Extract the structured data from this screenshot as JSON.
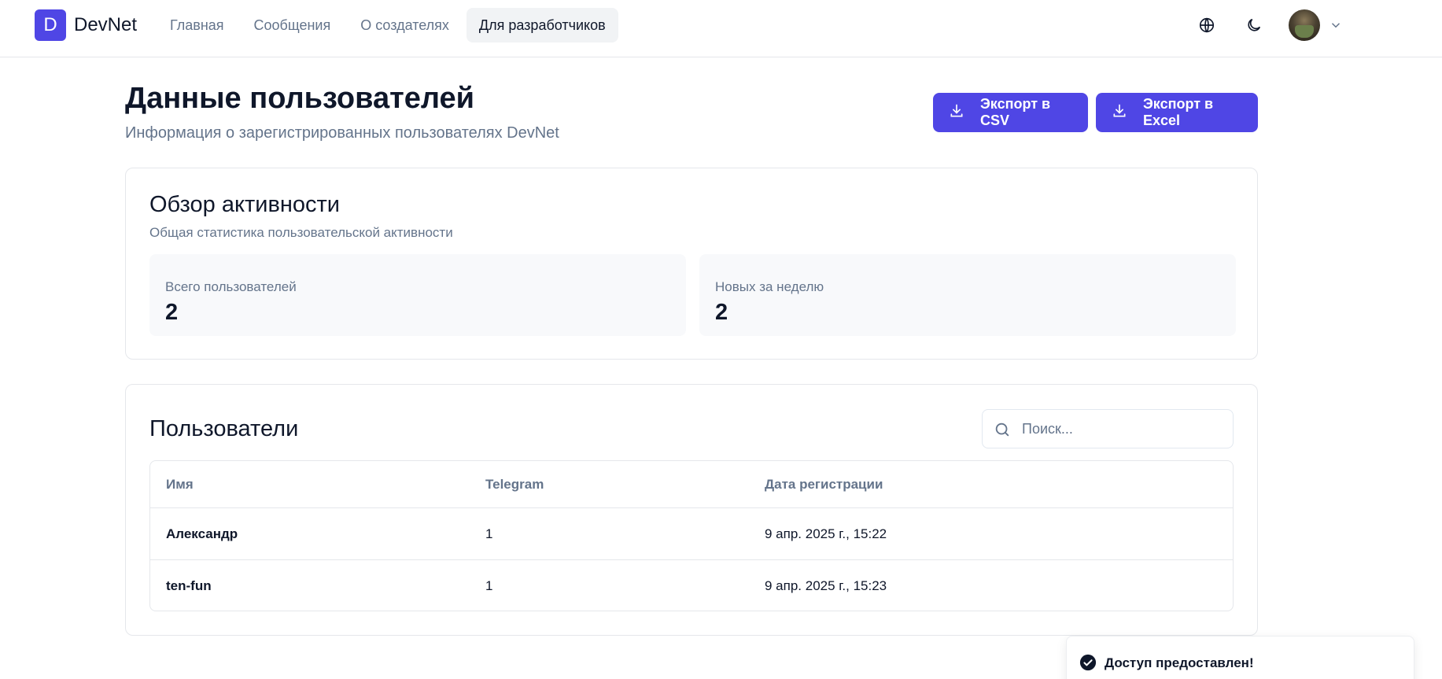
{
  "header": {
    "logo_letter": "D",
    "app_name": "DevNet",
    "nav": [
      {
        "label": "Главная",
        "active": false
      },
      {
        "label": "Сообщения",
        "active": false
      },
      {
        "label": "О создателях",
        "active": false
      },
      {
        "label": "Для разработчиков",
        "active": true
      }
    ],
    "icons": [
      "globe-icon",
      "moon-icon",
      "chevron-down-icon"
    ]
  },
  "page": {
    "title": "Данные пользователей",
    "subtitle": "Информация о зарегистрированных пользователях DevNet",
    "export_csv_label": "Экспорт в CSV",
    "export_excel_label": "Экспорт в Excel"
  },
  "activity": {
    "title": "Обзор активности",
    "subtitle": "Общая статистика пользовательской активности",
    "stats": [
      {
        "label": "Всего пользователей",
        "value": "2"
      },
      {
        "label": "Новых за неделю",
        "value": "2"
      }
    ]
  },
  "users": {
    "title": "Пользователи",
    "search_placeholder": "Поиск...",
    "search_value": "",
    "columns": [
      "Имя",
      "Telegram",
      "Дата регистрации"
    ],
    "rows": [
      {
        "name": "Александр",
        "telegram": "1",
        "registered": "9 апр. 2025 г., 15:22"
      },
      {
        "name": "ten-fun",
        "telegram": "1",
        "registered": "9 апр. 2025 г., 15:23"
      }
    ]
  },
  "toast": {
    "message": "Доступ предоставлен!"
  },
  "colors": {
    "accent": "#4f46e5",
    "muted_text": "#64748b",
    "border": "#e5e7eb"
  }
}
